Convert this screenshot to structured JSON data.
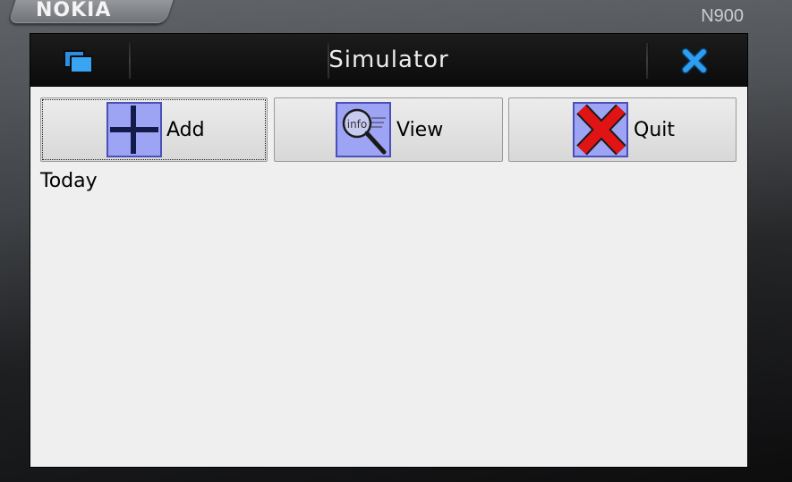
{
  "device": {
    "brand": "NOKIA",
    "model": "N900"
  },
  "titlebar": {
    "title": "Simulator",
    "switcher_icon": "task-switcher-icon",
    "close_icon": "close-icon",
    "switcher_color": "#39a4f2",
    "close_color": "#2e9ef0"
  },
  "toolbar": {
    "buttons": [
      {
        "label": "Add",
        "icon": "plus-icon"
      },
      {
        "label": "View",
        "icon": "magnifier-info-icon",
        "icon_text": "info"
      },
      {
        "label": "Quit",
        "icon": "red-x-icon"
      }
    ]
  },
  "content": {
    "heading": "Today"
  },
  "colors": {
    "screen_bg": "#efefef",
    "icon_bg": "#9ea4f4",
    "quit_red": "#e01414"
  }
}
